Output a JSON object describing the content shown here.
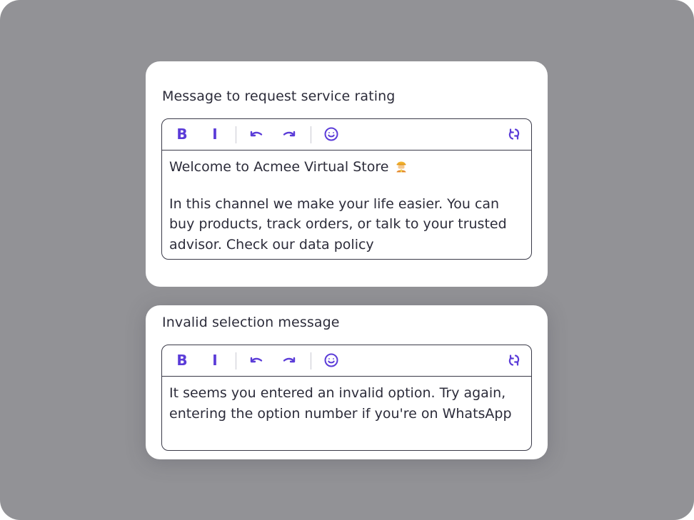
{
  "cards": [
    {
      "title": "Message to request service rating",
      "toolbar": {
        "bold_label": "B",
        "italic_label": "I",
        "icons": [
          "undo-icon",
          "redo-icon",
          "emoji-icon",
          "refresh-icon"
        ]
      },
      "paragraphs": [
        "Welcome to Acmee Virtual Store",
        "In this channel we make your life easier. You can buy products, track orders, or talk to your trusted advisor. Check our data policy"
      ],
      "inline_icon": "construction-worker-emoji"
    },
    {
      "title": "Invalid selection message",
      "toolbar": {
        "bold_label": "B",
        "italic_label": "I",
        "icons": [
          "undo-icon",
          "redo-icon",
          "emoji-icon",
          "refresh-icon"
        ]
      },
      "paragraphs": [
        "It seems you entered an invalid option. Try again, entering the option number if you're on WhatsApp"
      ]
    }
  ],
  "colors": {
    "background": "#929296",
    "card": "#ffffff",
    "accent": "#5b3cd8",
    "text": "#2c2c3a",
    "border": "#3a3a48"
  }
}
